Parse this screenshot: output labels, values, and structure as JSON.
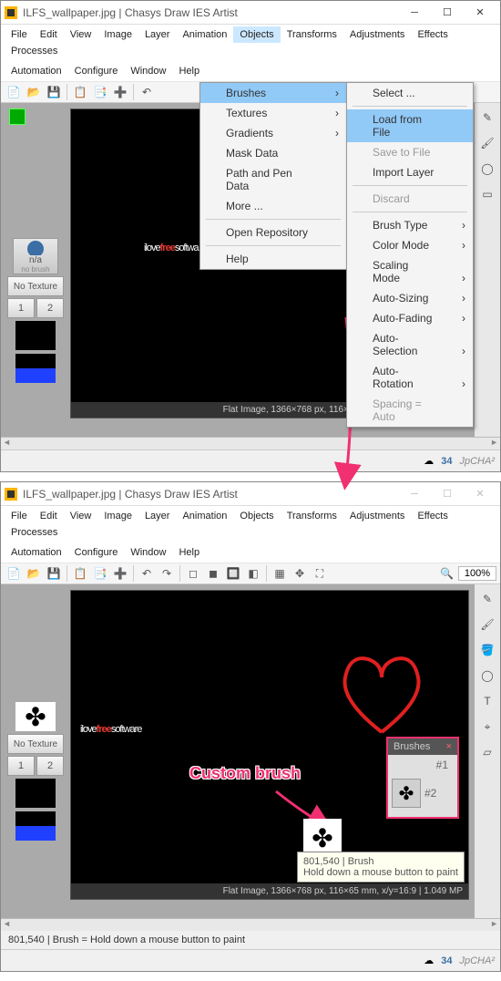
{
  "app": {
    "title": "ILFS_wallpaper.jpg | Chasys Draw IES Artist"
  },
  "menu1": [
    "File",
    "Edit",
    "View",
    "Image",
    "Layer",
    "Animation",
    "Objects",
    "Transforms",
    "Adjustments",
    "Effects",
    "Processes"
  ],
  "menu2": [
    "Automation",
    "Configure",
    "Window",
    "Help"
  ],
  "objects_menu": {
    "brushes": "Brushes",
    "textures": "Textures",
    "gradients": "Gradients",
    "mask": "Mask Data",
    "path": "Path and Pen Data",
    "more": "More ...",
    "repo": "Open Repository",
    "help": "Help"
  },
  "brushes_sub": {
    "select": "Select ...",
    "load": "Load from File",
    "save": "Save to File",
    "import": "Import Layer",
    "discard": "Discard",
    "btype": "Brush Type",
    "cmode": "Color Mode",
    "smode": "Scaling Mode",
    "asizing": "Auto-Sizing",
    "afading": "Auto-Fading",
    "aselect": "Auto-Selection",
    "arot": "Auto-Rotation",
    "spacing": "Spacing = Auto"
  },
  "left": {
    "na": "n/a",
    "nobrush": "no brush",
    "notex": "No Texture",
    "b1": "1",
    "b2": "2"
  },
  "logo": {
    "a": "ilove",
    "b": "free",
    "c": "softwa",
    "c2": "software"
  },
  "status": "Flat Image, 1366×768 px, 116×65 mm, x/y=16:9 | 1.049 MP",
  "footer": {
    "count": "34",
    "brand": "JpCHA²"
  },
  "annotation": {
    "custombrush": "Custom brush"
  },
  "brushes_panel": {
    "title": "Brushes",
    "s1": "#1",
    "s2": "#2"
  },
  "tooltip": {
    "coord": "801,540 | Brush",
    "hint": "Hold down a mouse button to paint"
  },
  "status2": "801,540 | Brush = Hold down a mouse button to paint",
  "zoom": "100%"
}
